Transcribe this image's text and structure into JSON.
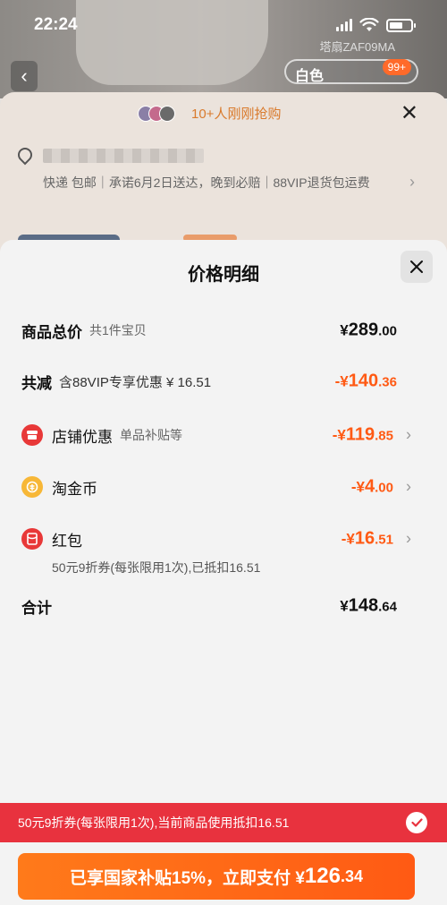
{
  "status_bar": {
    "time": "22:24"
  },
  "background": {
    "sku_code": "塔扇ZAF09MA",
    "chip_text": "白色",
    "cart_badge": "99+",
    "hot_text": "10+人刚刚抢购",
    "shipping_line": "快递 包邮｜承诺6月2日送达，晚到必赔｜88VIP退货包运费"
  },
  "modal": {
    "title": "价格明细",
    "rows": {
      "total": {
        "label": "商品总价",
        "sub": "共1件宝贝",
        "yen": "¥",
        "amount_int": "289",
        "amount_dec": ".00"
      },
      "reduction": {
        "label": "共减",
        "sub": "含88VIP专享优惠 ¥ 16.51",
        "prefix": "-¥",
        "amount_int": "140",
        "amount_dec": ".36"
      },
      "shop": {
        "label": "店铺优惠",
        "sub": "单品补贴等",
        "prefix": "-¥",
        "amount_int": "119",
        "amount_dec": ".85"
      },
      "coin": {
        "label": "淘金币",
        "prefix": "-¥",
        "amount_int": "4",
        "amount_dec": ".00"
      },
      "redpack": {
        "label": "红包",
        "prefix": "-¥",
        "amount_int": "16",
        "amount_dec": ".51",
        "note": "50元9折券(每张限用1次),已抵扣16.51"
      },
      "sum": {
        "label": "合计",
        "yen": "¥",
        "amount_int": "148",
        "amount_dec": ".64"
      }
    }
  },
  "coupon_bar": {
    "text": "50元9折券(每张限用1次),当前商品使用抵扣16.51"
  },
  "pay_button": {
    "label": "已享国家补贴15%，立即支付 ¥",
    "amount_int": "126",
    "amount_dec": ".34"
  },
  "colors": {
    "accent_orange": "#ff5a14",
    "coupon_red": "#e8323e"
  }
}
